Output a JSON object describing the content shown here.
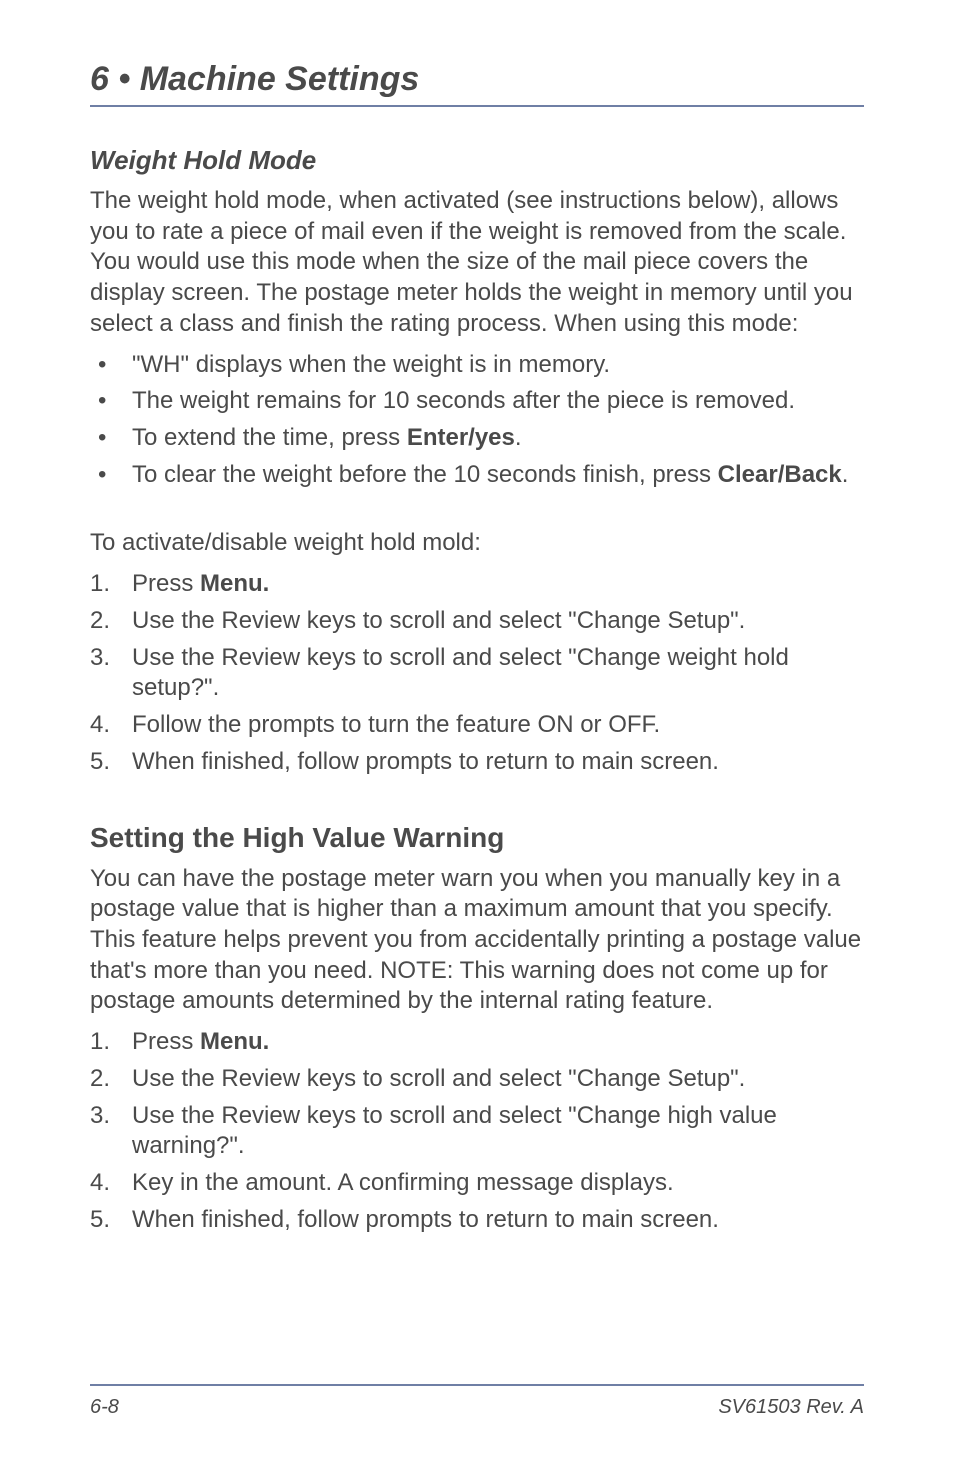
{
  "chapter_title": "6 • Machine Settings",
  "section1": {
    "heading": "Weight Hold Mode",
    "intro": "The weight hold mode, when activated (see instructions below), allows you to rate a piece of mail even if the weight is removed from the scale. You would use this mode when the size of the mail piece covers the display screen. The postage meter holds the weight in memory until you select a class and finish the rating process. When using this mode:",
    "bullets": [
      {
        "pre": "\"WH\" displays when the weight is in memory."
      },
      {
        "pre": "The weight remains for 10 seconds after the piece is removed."
      },
      {
        "pre": "To extend the time, press ",
        "bold": "Enter/yes",
        "post": "."
      },
      {
        "pre": "To clear the weight before the 10 seconds finish, press ",
        "bold": "Clear/Back",
        "post": "."
      }
    ],
    "activate_intro": "To activate/disable weight hold mold:",
    "steps": [
      {
        "pre": "Press ",
        "bold": "Menu."
      },
      {
        "pre": "Use the Review keys to scroll and select \"Change Setup\"."
      },
      {
        "pre": "Use the Review keys to scroll and select \"Change weight hold setup?\"."
      },
      {
        "pre": "Follow the prompts to turn the feature ON or OFF."
      },
      {
        "pre": "When finished, follow prompts to return to main screen."
      }
    ]
  },
  "section2": {
    "heading": "Setting the High Value Warning",
    "intro": "You can have the postage meter warn you when you manually key in a postage value that is higher than a maximum amount that you specify. This feature helps prevent you from accidentally printing a postage value that's more than you need. NOTE: This warning does not come up for postage amounts determined by the internal rating feature.",
    "steps": [
      {
        "pre": "Press ",
        "bold": "Menu."
      },
      {
        "pre": "Use the Review keys to scroll and select \"Change Setup\"."
      },
      {
        "pre": "Use the Review keys to scroll and select \"Change high value warning?\"."
      },
      {
        "pre": "Key in the amount. A confirming message displays."
      },
      {
        "pre": "When finished, follow prompts to return to main screen."
      }
    ]
  },
  "footer": {
    "page": "6-8",
    "doc": "SV61503 Rev. A"
  }
}
